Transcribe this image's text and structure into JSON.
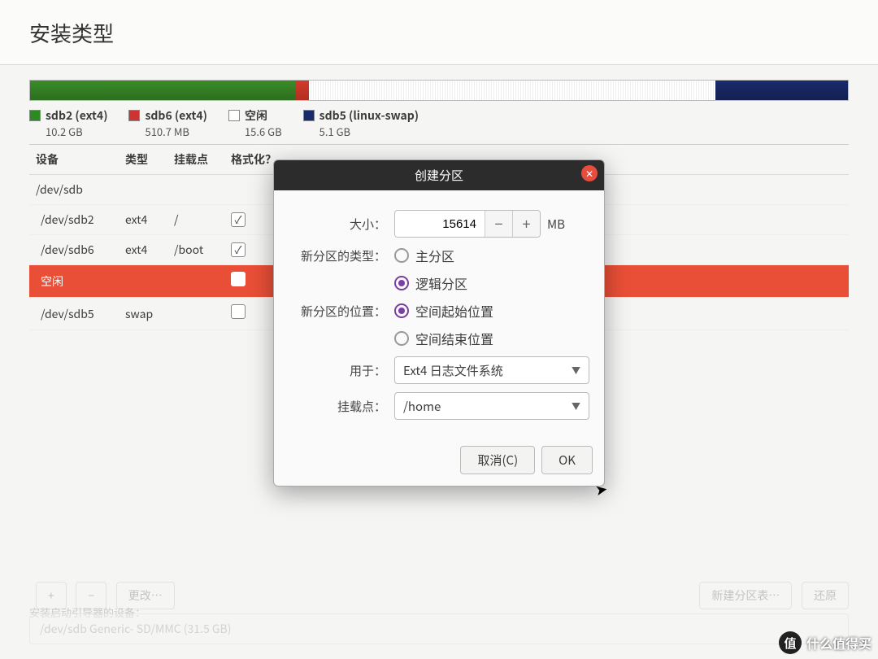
{
  "header": {
    "title": "安装类型"
  },
  "legend": [
    {
      "color": "g",
      "label": "sdb2 (ext4)",
      "size": "10.2 GB"
    },
    {
      "color": "r",
      "label": "sdb6 (ext4)",
      "size": "510.7 MB"
    },
    {
      "color": "w",
      "label": "空闲",
      "size": "15.6 GB"
    },
    {
      "color": "b",
      "label": "sdb5 (linux-swap)",
      "size": "5.1 GB"
    }
  ],
  "columns": {
    "device": "设备",
    "type": "类型",
    "mount": "挂载点",
    "format": "格式化？"
  },
  "rows": [
    {
      "device": "/dev/sdb",
      "type": "",
      "mount": "",
      "fmt": null,
      "drive": true
    },
    {
      "device": "/dev/sdb2",
      "type": "ext4",
      "mount": "/",
      "fmt": true
    },
    {
      "device": "/dev/sdb6",
      "type": "ext4",
      "mount": "/boot",
      "fmt": true
    },
    {
      "device": "空闲",
      "type": "",
      "mount": "",
      "fmt": false,
      "selected": true
    },
    {
      "device": "/dev/sdb5",
      "type": "swap",
      "mount": "",
      "fmt": false
    }
  ],
  "toolbar": {
    "add": "+",
    "remove": "−",
    "change": "更改…",
    "new_table": "新建分区表…",
    "revert": "还原"
  },
  "boot_label": "安装启动引导器的设备：",
  "boot_device": "/dev/sdb   Generic- SD/MMC (31.5 GB)",
  "modal": {
    "title": "创建分区",
    "size_label": "大小：",
    "size_value": "15614",
    "size_unit": "MB",
    "type_label": "新分区的类型：",
    "type_primary": "主分区",
    "type_logical": "逻辑分区",
    "pos_label": "新分区的位置：",
    "pos_begin": "空间起始位置",
    "pos_end": "空间结束位置",
    "use_label": "用于：",
    "use_value": "Ext4 日志文件系统",
    "mount_label": "挂载点：",
    "mount_value": "/home",
    "cancel": "取消(C)",
    "ok": "OK"
  },
  "watermark": {
    "badge": "值",
    "text": "什么值得买"
  }
}
